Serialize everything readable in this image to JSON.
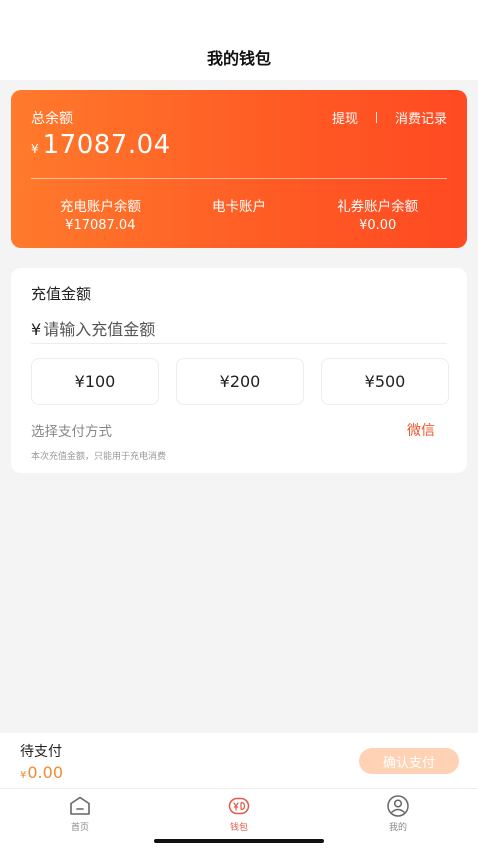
{
  "header": {
    "title": "我的钱包"
  },
  "balance_card": {
    "total_label": "总余额",
    "currency": "¥",
    "total_value": "17087.04",
    "withdraw_label": "提现",
    "records_label": "消费记录",
    "accounts": [
      {
        "label": "充电账户余额",
        "value": "¥17087.04"
      },
      {
        "label": "电卡账户",
        "value": ""
      },
      {
        "label": "礼券账户余额",
        "value": "¥0.00"
      }
    ]
  },
  "recharge": {
    "title": "充值金额",
    "currency": "¥",
    "placeholder": "请输入充值金额",
    "presets": [
      "¥100",
      "¥200",
      "¥500"
    ],
    "pay_method_label": "选择支付方式",
    "pay_method_value": "微信",
    "note": "本次充值金额，只能用于充电消费"
  },
  "pay_bar": {
    "label": "待支付",
    "currency": "¥",
    "amount": "0.00",
    "confirm_label": "确认支付"
  },
  "tabs": [
    {
      "label": "首页",
      "icon": "home-icon",
      "active": false
    },
    {
      "label": "钱包",
      "icon": "wallet-icon",
      "active": true
    },
    {
      "label": "我的",
      "icon": "profile-icon",
      "active": false
    }
  ],
  "colors": {
    "accent": "#ff5a24",
    "gradient_start": "#ff7a2c",
    "gradient_end": "#ff4a22",
    "pay_method": "#e8542c",
    "amount_orange": "#f08a34",
    "confirm_disabled": "#ffd2b6",
    "tab_active": "#e05b4a"
  }
}
